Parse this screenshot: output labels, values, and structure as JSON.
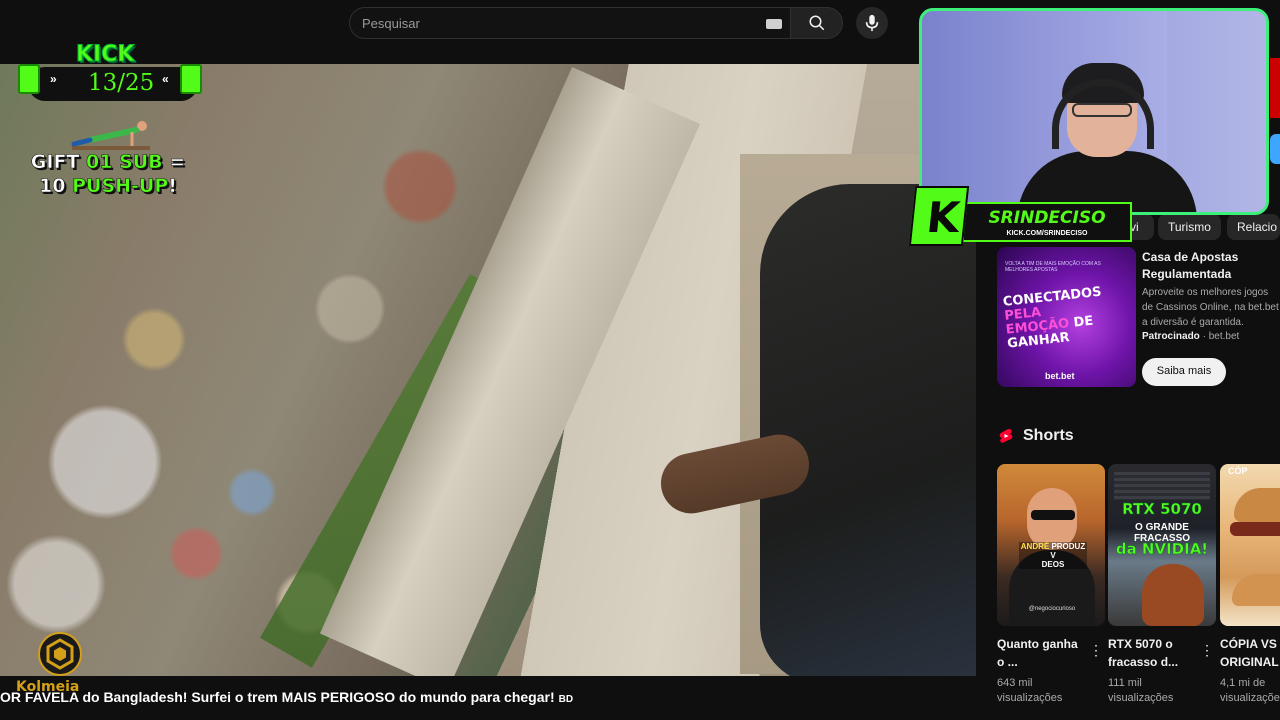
{
  "search": {
    "placeholder": "Pesquisar"
  },
  "overlay": {
    "kick_word": "KICK",
    "kick_counter": "13/25",
    "gift_line1_a": "GIFT ",
    "gift_line1_b": "01",
    "gift_line1_c": " SUB",
    "gift_line1_d": " =",
    "gift_line2_a": "10 ",
    "gift_line2_b": "PUSH-UP",
    "gift_line2_c": "!",
    "streamer_name": "SRINDECISO",
    "streamer_url": "KICK.COM/SRINDECISO",
    "hive_name": "Kolmeia",
    "accent_color": "#53fc18"
  },
  "chips": [
    "vi",
    "Turismo",
    "Relacio"
  ],
  "ad": {
    "thumb_small": "VOLTA A TIM DE MAIS EMOÇÃO COM AS MELHORES APOSTAS",
    "thumb_headline_a": "CONECTADOS ",
    "thumb_headline_b": "PELA EMOÇÃO",
    "thumb_headline_c": " DE GANHAR",
    "thumb_brand": "bet.bet",
    "title": "Casa de Apostas Regulamentada",
    "description": "Aproveite os melhores jogos de Cassinos Online, na bet.bet a diversão é garantida.",
    "sponsored_label": "Patrocinado",
    "advertiser": "bet.bet",
    "cta": "Saiba mais"
  },
  "shorts": {
    "heading": "Shorts",
    "items": [
      {
        "title": "Quanto ganha o ...",
        "views": "643 mil visualizações",
        "thumb_caption_a": "ANDRÉ ",
        "thumb_caption_b": "PRODUZ V",
        "thumb_caption_c": "DEOS",
        "thumb_handle": "@negociocurioso"
      },
      {
        "title": "RTX 5070 o fracasso d...",
        "views": "111 mil visualizações",
        "thumb_line1": "RTX 5070",
        "thumb_line2": "O GRANDE FRACASSO",
        "thumb_line3": "da NVIDIA!"
      },
      {
        "title": "CÓPIA VS ORIGINAL",
        "views": "4,1 mi de visualizações",
        "thumb_label": "CÓP"
      }
    ]
  },
  "video": {
    "title": "OR FAVELA do Bangladesh! Surfei o trem MAIS PERIGOSO do mundo para chegar!",
    "title_suffix": "BD"
  }
}
